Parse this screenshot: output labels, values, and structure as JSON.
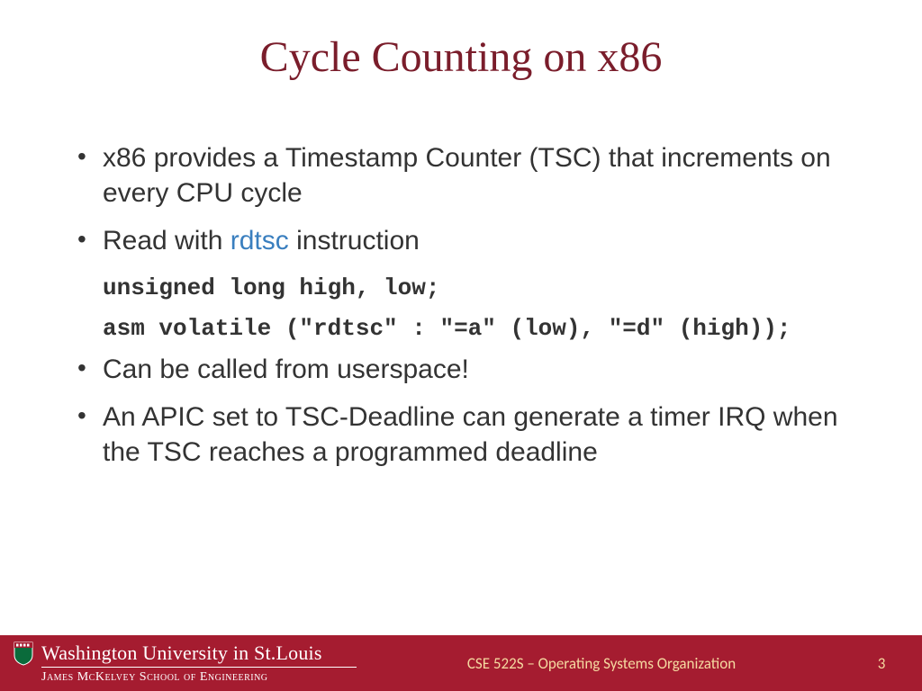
{
  "title": "Cycle Counting on x86",
  "bullets": {
    "b1": "x86 provides a Timestamp Counter (TSC) that increments on every CPU cycle",
    "b2_pre": "Read with ",
    "b2_kw": "rdtsc",
    "b2_post": " instruction",
    "code1": "unsigned long high, low;",
    "code2": "asm volatile (\"rdtsc\" : \"=a\" (low), \"=d\" (high));",
    "b3": "Can be called from userspace!",
    "b4": "An APIC set to TSC-Deadline can generate a timer IRQ when the TSC reaches a programmed deadline"
  },
  "footer": {
    "university": "Washington University in St.Louis",
    "school": "James McKelvey School of Engineering",
    "course": "CSE 522S – Operating Systems Organization",
    "page": "3"
  }
}
